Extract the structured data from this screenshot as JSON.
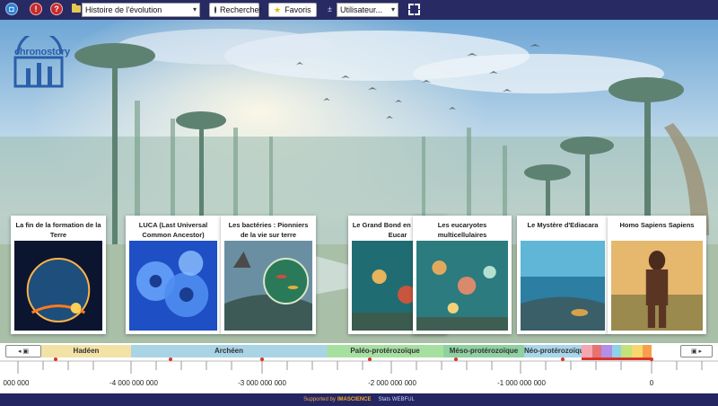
{
  "toolbar": {
    "history_select": "Histoire de l'évolution",
    "search_label": "Rechercher",
    "favorites_label": "Favoris",
    "user_select": "Utilisateur...",
    "round_buttons": [
      {
        "icon": "home-icon",
        "glyph": "◘"
      },
      {
        "icon": "info-icon",
        "glyph": "!"
      },
      {
        "icon": "help-icon",
        "glyph": "?"
      }
    ]
  },
  "logo": {
    "text": "chronostory"
  },
  "cards": [
    {
      "title": "La fin de la formation de la Terre",
      "image": "earth-formation"
    },
    {
      "title": "LUCA (Last Universal Common Ancestor)",
      "image": "cells"
    },
    {
      "title": "Les bactéries : Pionniers de la vie sur terre",
      "image": "bacteria"
    },
    {
      "title": "Le Grand Bond en L'Ère des Eucar",
      "image": "reef"
    },
    {
      "title": "Les eucaryotes multicellulaires",
      "image": "reef2"
    },
    {
      "title": "Le Mystère d'Ediacara",
      "image": "ediacara"
    },
    {
      "title": "Homo Sapiens Sapiens",
      "image": "human"
    }
  ],
  "timeline": {
    "eras": [
      {
        "name": "Hadéen",
        "color": "#f2e2a6"
      },
      {
        "name": "Archéen",
        "color": "#a9d4e6"
      },
      {
        "name": "Paléo-protérozoïque",
        "color": "#a6e0a1"
      },
      {
        "name": "Méso-protérozoïque",
        "color": "#8fd1a1"
      },
      {
        "name": "Néo-protérozoïque",
        "color": "#a9d6ea"
      }
    ],
    "axis_labels": [
      "000 000",
      "-4 000 000 000",
      "-3 000 000 000",
      "-2 000 000 000",
      "-1 000 000 000",
      "0"
    ]
  },
  "footer": {
    "supported_by": "Supported by",
    "brand": "IMASCIENCE",
    "stats": "Stats WEBFUL"
  }
}
